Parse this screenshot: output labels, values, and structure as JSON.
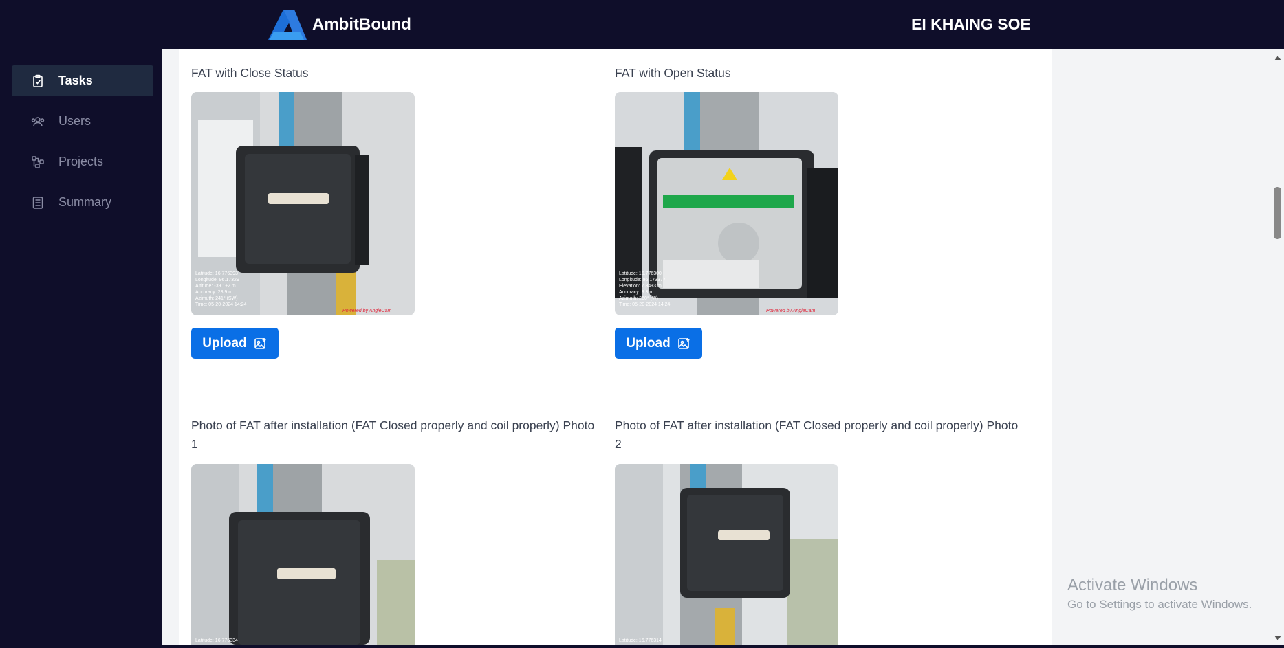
{
  "header": {
    "app_name": "AmbitBound",
    "user_name": "EI KHAING SOE",
    "brand_color": "#0f0e2a",
    "logo_color": "#1d6fd8"
  },
  "sidebar": {
    "items": [
      {
        "label": "Tasks",
        "icon": "clipboard-check-icon",
        "active": true
      },
      {
        "label": "Users",
        "icon": "users-icon",
        "active": false
      },
      {
        "label": "Projects",
        "icon": "workflow-icon",
        "active": false
      },
      {
        "label": "Summary",
        "icon": "document-list-icon",
        "active": false
      }
    ]
  },
  "main": {
    "fields": [
      {
        "label": "FAT with Close Status",
        "upload_label": "Upload",
        "photo": "fat-box-closed-photo"
      },
      {
        "label": "FAT with Open Status",
        "upload_label": "Upload",
        "photo": "fat-box-open-photo"
      },
      {
        "label": "Photo of FAT after installation (FAT Closed properly and coil properly) Photo 1",
        "photo": "fat-after-install-photo-1"
      },
      {
        "label": "Photo of FAT after installation (FAT Closed properly and coil properly) Photo 2",
        "photo": "fat-after-install-photo-2"
      }
    ],
    "upload_color": "#0a6fe6"
  },
  "watermark": {
    "title": "Activate Windows",
    "subtitle": "Go to Settings to activate Windows."
  }
}
